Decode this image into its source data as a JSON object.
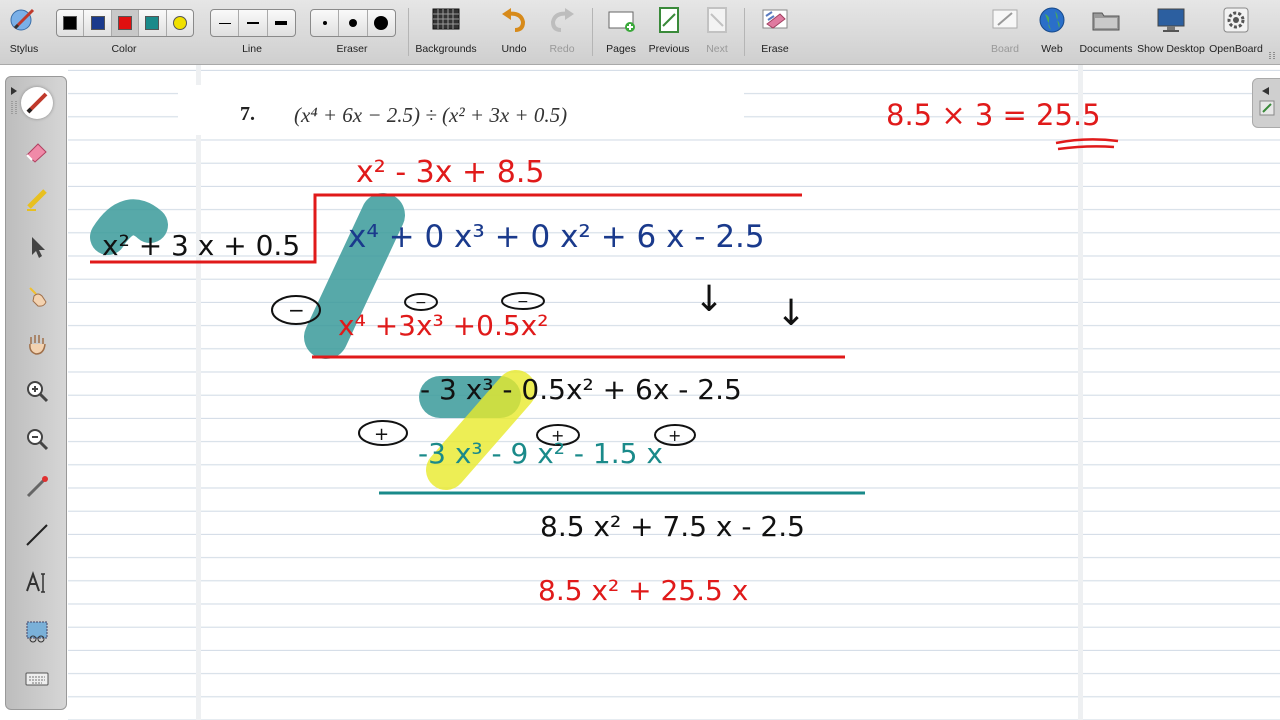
{
  "toolbar": {
    "stylus": "Stylus",
    "color": "Color",
    "line": "Line",
    "eraser": "Eraser",
    "backgrounds": "Backgrounds",
    "undo": "Undo",
    "redo": "Redo",
    "pages": "Pages",
    "previous": "Previous",
    "next": "Next",
    "erase": "Erase",
    "board": "Board",
    "web": "Web",
    "documents": "Documents",
    "show_desktop": "Show Desktop",
    "openboard": "OpenBoard",
    "colors": [
      "#000000",
      "#1a3a8c",
      "#e01010",
      "#1a8a8a",
      "#f0e000"
    ]
  },
  "problem": {
    "number": "7.",
    "expression": "(x⁴ + 6x − 2.5) ÷ (x² + 3x + 0.5)"
  },
  "ink": {
    "side_note": "8.5 × 3 = 25.5",
    "divisor": "x² + 3 x + 0.5",
    "quotient": "x² - 3x + 8.5",
    "dividend": "x⁴ + 0 x³ + 0 x² + 6 x - 2.5",
    "sub1_sign": "−",
    "sub1_op_a": "−",
    "sub1_op_b": "−",
    "sub1": "x⁴ +3x³ +0.5x²",
    "rem1": "- 3 x³ - 0.5x² + 6x - 2.5",
    "sub2_sign": "+",
    "sub2_op_a": "+",
    "sub2_op_b": "+",
    "sub2": "-3 x³ - 9 x² - 1.5 x",
    "rem2": "8.5 x² + 7.5 x - 2.5",
    "sub3": "8.5 x² + 25.5 x",
    "arrow": "↓"
  }
}
